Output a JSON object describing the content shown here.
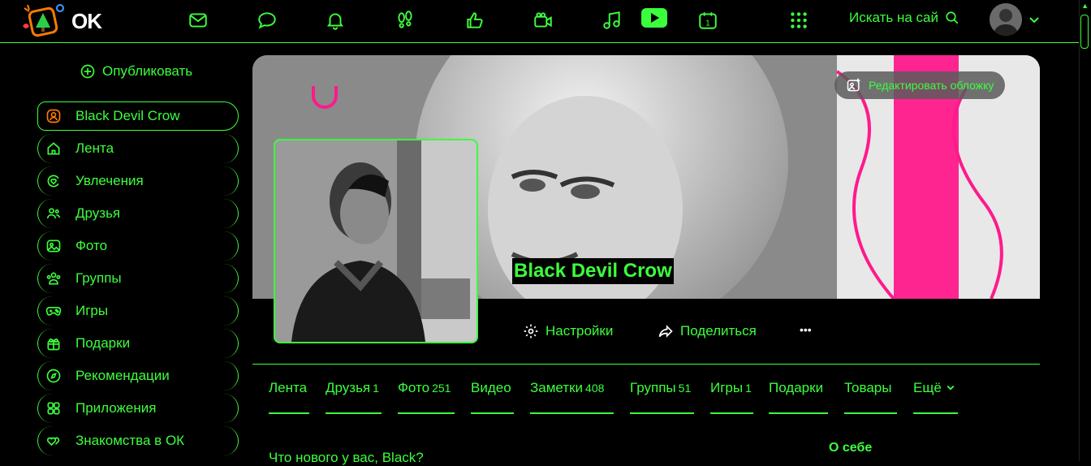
{
  "app": {
    "logo_text": "OK"
  },
  "topbar": {
    "icons": [
      "mail-icon",
      "chat-icon",
      "bell-icon",
      "footprints-icon",
      "thumbs-up-icon",
      "camera-icon",
      "music-icon",
      "video-play-icon",
      "calendar-icon",
      "apps-grid-icon"
    ],
    "calendar_day": "1",
    "search_label": "Искать на сай"
  },
  "sidebar": {
    "publish_label": "Опубликовать",
    "items": [
      {
        "label": "Black Devil Crow",
        "icon": "user-icon",
        "active": true
      },
      {
        "label": "Лента",
        "icon": "home-icon"
      },
      {
        "label": "Увлечения",
        "icon": "hobby-icon"
      },
      {
        "label": "Друзья",
        "icon": "friends-icon"
      },
      {
        "label": "Фото",
        "icon": "photo-icon"
      },
      {
        "label": "Группы",
        "icon": "groups-icon"
      },
      {
        "label": "Игры",
        "icon": "gamepad-icon"
      },
      {
        "label": "Подарки",
        "icon": "gift-icon"
      },
      {
        "label": "Рекомендации",
        "icon": "compass-icon"
      },
      {
        "label": "Приложения",
        "icon": "apps-icon"
      },
      {
        "label": "Знакомства в ОК",
        "icon": "hearts-icon"
      }
    ]
  },
  "profile": {
    "edit_cover_label": "Редактировать обложку",
    "name": "Black Devil Crow",
    "settings_label": "Настройки",
    "share_label": "Поделиться",
    "more_label": "•••"
  },
  "tabs": [
    {
      "label": "Лента",
      "count": ""
    },
    {
      "label": "Друзья",
      "count": "1"
    },
    {
      "label": "Фото",
      "count": "251"
    },
    {
      "label": "Видео",
      "count": ""
    },
    {
      "label": "Заметки",
      "count": "408"
    },
    {
      "label": "Группы",
      "count": "51"
    },
    {
      "label": "Игры",
      "count": "1"
    },
    {
      "label": "Подарки",
      "count": ""
    },
    {
      "label": "Товары",
      "count": ""
    },
    {
      "label": "Ещё",
      "count": ""
    }
  ],
  "feed": {
    "whats_new_placeholder": "Что нового у вас, Black?"
  },
  "about": {
    "title": "О себе"
  },
  "colors": {
    "accent": "#3cff3c",
    "background": "#000000",
    "brand_orange": "#ff7a00",
    "cover_pink": "#ff1a8c"
  }
}
